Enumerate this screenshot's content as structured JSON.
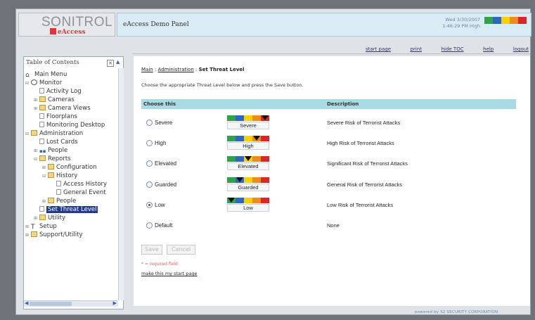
{
  "header": {
    "brand": "SONITROL",
    "sub_brand": "eAccess",
    "panel_title": "eAccess Demo Panel",
    "date": "Wed 3/30/2007",
    "time_level": "1:46:29 PM  High"
  },
  "colors": {
    "severe": "#d8262b",
    "high": "#f08a1b",
    "elevated": "#f6d200",
    "guarded": "#2d67c6",
    "low": "#2fa24a",
    "table_header": "#a9dbe4",
    "title_bar": "#d9ebf4",
    "toc_selected": "#213b89"
  },
  "top_links": [
    "start page",
    "print",
    "hide TOC",
    "help",
    "logout"
  ],
  "toc": {
    "title": "Table of Contents",
    "items": [
      {
        "label": "Main Menu"
      },
      {
        "label": "Monitor"
      },
      {
        "label": "Activity Log"
      },
      {
        "label": "Cameras"
      },
      {
        "label": "Camera Views"
      },
      {
        "label": "Floorplans"
      },
      {
        "label": "Monitoring Desktop"
      },
      {
        "label": "Administration"
      },
      {
        "label": "Lost Cards"
      },
      {
        "label": "People"
      },
      {
        "label": "Reports"
      },
      {
        "label": "Configuration"
      },
      {
        "label": "History"
      },
      {
        "label": "Access History"
      },
      {
        "label": "General Event"
      },
      {
        "label": "People"
      },
      {
        "label": "Set Threat Level"
      },
      {
        "label": "Utility"
      },
      {
        "label": "Setup"
      },
      {
        "label": "Support/Utility"
      }
    ]
  },
  "breadcrumb": {
    "main": "Main",
    "sep1": ":",
    "admin": "Administration",
    "sep2": ":",
    "current": "Set Threat Level"
  },
  "instruction": "Choose the appropriate Threat Level below and press the Save button.",
  "table": {
    "col_choose": "Choose this",
    "col_desc": "Description",
    "rows": [
      {
        "option": "Severe",
        "meter_label": "Severe",
        "desc": "Severe Risk of Terrorist Attacks",
        "needle_index": 4
      },
      {
        "option": "High",
        "meter_label": "High",
        "desc": "High Risk of Terrorist Attacks",
        "needle_index": 3
      },
      {
        "option": "Elevated",
        "meter_label": "Elevated",
        "desc": "Significant Risk of Terrorist Attacks",
        "needle_index": 2
      },
      {
        "option": "Guarded",
        "meter_label": "Guarded",
        "desc": "General Risk of Terrorist Attacks",
        "needle_index": 1
      },
      {
        "option": "Low",
        "meter_label": "Low",
        "desc": "Low Risk of Terrorist Attacks",
        "needle_index": 0,
        "selected": true
      },
      {
        "option": "Default",
        "desc": "None"
      }
    ]
  },
  "buttons": {
    "save": "Save",
    "cancel": "Cancel"
  },
  "required_note": "* = required field",
  "start_page_link": "make this my start page",
  "footer": "powered by S2 SECURITY CORPORATION"
}
